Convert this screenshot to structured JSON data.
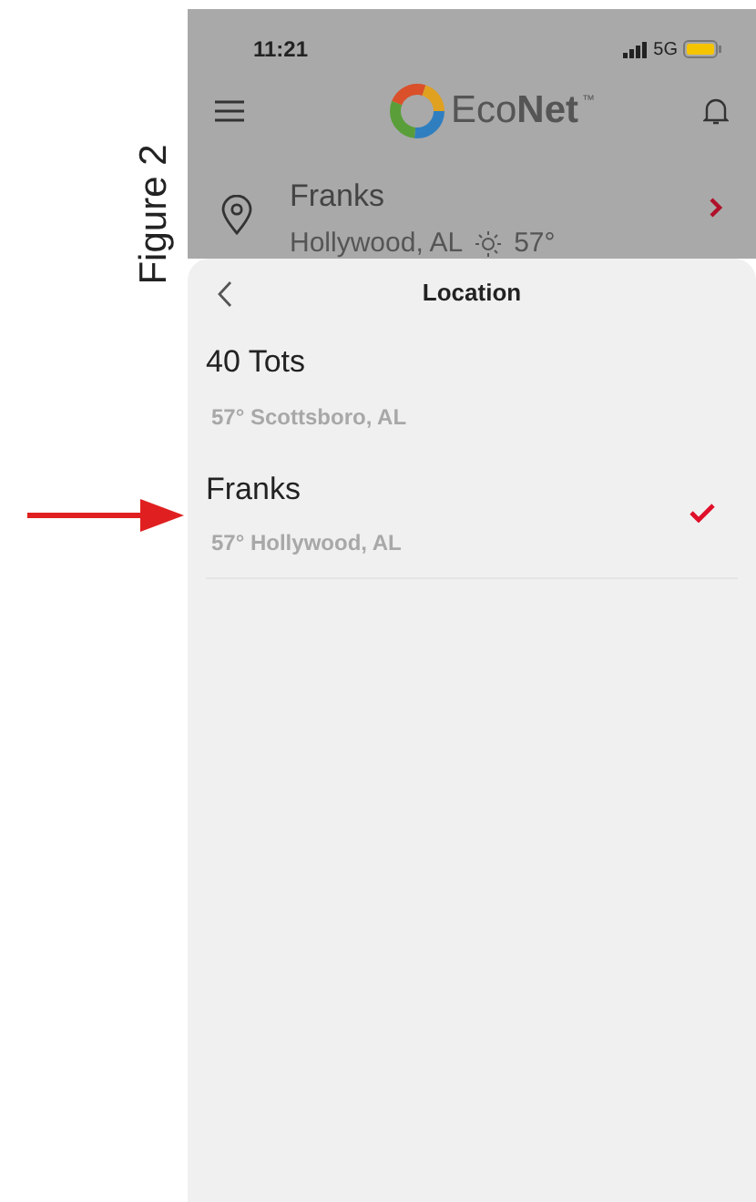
{
  "figure_label": "Figure 2",
  "status_bar": {
    "time": "11:21",
    "network": "5G"
  },
  "header": {
    "brand": "Eco**Net**",
    "trademark": "™"
  },
  "current_location": {
    "name": "Franks",
    "city": "Hollywood, AL",
    "temperature": "57°"
  },
  "sheet": {
    "title": "Location"
  },
  "locations": [
    {
      "name": "40 Tots",
      "detail": "57° Scottsboro, AL",
      "selected": false
    },
    {
      "name": "Franks",
      "detail": "57° Hollywood, AL",
      "selected": true
    }
  ]
}
